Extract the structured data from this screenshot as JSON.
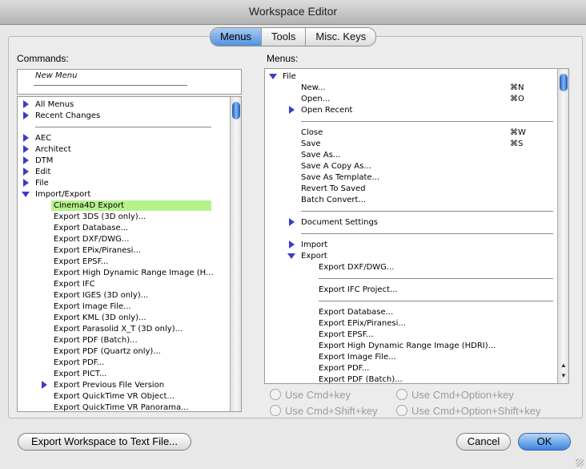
{
  "window": {
    "title": "Workspace Editor"
  },
  "tabs": [
    {
      "label": "Menus",
      "selected": true
    },
    {
      "label": "Tools",
      "selected": false
    },
    {
      "label": "Misc. Keys",
      "selected": false
    }
  ],
  "commands": {
    "label": "Commands:",
    "new_menu": "New Menu",
    "items": [
      {
        "label": "All Menus",
        "icon": "disclosure-right-icon"
      },
      {
        "label": "Recent Changes",
        "icon": "disclosure-right-icon"
      },
      {
        "separator": true
      },
      {
        "label": "AEC",
        "icon": "disclosure-right-icon"
      },
      {
        "label": "Architect",
        "icon": "disclosure-right-icon"
      },
      {
        "label": "DTM",
        "icon": "disclosure-right-icon"
      },
      {
        "label": "Edit",
        "icon": "disclosure-right-icon"
      },
      {
        "label": "File",
        "icon": "disclosure-right-icon"
      },
      {
        "label": "Import/Export",
        "icon": "disclosure-down-icon"
      },
      {
        "label": "Cinema4D Export",
        "indent": true,
        "highlight": true
      },
      {
        "label": "Export 3DS (3D only)...",
        "indent": true
      },
      {
        "label": "Export Database...",
        "indent": true
      },
      {
        "label": "Export DXF/DWG...",
        "indent": true
      },
      {
        "label": "Export EPix/Piranesi...",
        "indent": true
      },
      {
        "label": "Export EPSF...",
        "indent": true
      },
      {
        "label": "Export High Dynamic Range Image (H...",
        "indent": true
      },
      {
        "label": "Export IFC",
        "indent": true
      },
      {
        "label": "Export IGES (3D only)...",
        "indent": true
      },
      {
        "label": "Export Image File...",
        "indent": true
      },
      {
        "label": "Export KML (3D only)...",
        "indent": true
      },
      {
        "label": "Export Parasolid X_T (3D only)...",
        "indent": true
      },
      {
        "label": "Export PDF (Batch)...",
        "indent": true
      },
      {
        "label": "Export PDF (Quartz only)...",
        "indent": true
      },
      {
        "label": "Export PDF...",
        "indent": true
      },
      {
        "label": "Export PICT...",
        "indent": true
      },
      {
        "label": "Export Previous File Version",
        "indent": true,
        "icon": "disclosure-right-icon"
      },
      {
        "label": "Export QuickTime VR Object...",
        "indent": true
      },
      {
        "label": "Export QuickTime VR Panorama...",
        "indent": true
      }
    ]
  },
  "menus": {
    "label": "Menus:",
    "items": [
      {
        "label": "File",
        "level": 0,
        "icon": "disclosure-down-icon"
      },
      {
        "label": "New...",
        "level": 1,
        "shortcut": "⌘N"
      },
      {
        "label": "Open...",
        "level": 1,
        "shortcut": "⌘O"
      },
      {
        "label": "Open Recent",
        "level": 1,
        "icon": "disclosure-right-icon"
      },
      {
        "separator": true,
        "level": 1
      },
      {
        "label": "Close",
        "level": 1,
        "shortcut": "⌘W"
      },
      {
        "label": "Save",
        "level": 1,
        "shortcut": "⌘S"
      },
      {
        "label": "Save As...",
        "level": 1
      },
      {
        "label": "Save A Copy As...",
        "level": 1
      },
      {
        "label": "Save As Template...",
        "level": 1
      },
      {
        "label": "Revert To Saved",
        "level": 1
      },
      {
        "label": "Batch Convert...",
        "level": 1
      },
      {
        "separator": true,
        "level": 1
      },
      {
        "label": "Document Settings",
        "level": 1,
        "icon": "disclosure-right-icon"
      },
      {
        "separator": true,
        "level": 1
      },
      {
        "label": "Import",
        "level": 1,
        "icon": "disclosure-right-icon"
      },
      {
        "label": "Export",
        "level": 1,
        "icon": "disclosure-down-icon"
      },
      {
        "label": "Export DXF/DWG...",
        "level": 2
      },
      {
        "separator": true,
        "level": 2
      },
      {
        "label": "Export IFC Project...",
        "level": 2
      },
      {
        "separator": true,
        "level": 2
      },
      {
        "label": "Export Database...",
        "level": 2
      },
      {
        "label": "Export EPix/Piranesi...",
        "level": 2
      },
      {
        "label": "Export EPSF...",
        "level": 2
      },
      {
        "label": "Export High Dynamic Range Image (HDRI)...",
        "level": 2
      },
      {
        "label": "Export Image File...",
        "level": 2
      },
      {
        "label": "Export PDF...",
        "level": 2
      },
      {
        "label": "Export PDF (Batch)...",
        "level": 2
      }
    ]
  },
  "shortcut_options": [
    "Use Cmd+key",
    "Use Cmd+Option+key",
    "Use Cmd+Shift+key",
    "Use Cmd+Option+Shift+key"
  ],
  "buttons": {
    "export": "Export Workspace to Text File...",
    "cancel": "Cancel",
    "ok": "OK"
  },
  "colors": {
    "highlight": "#b6f28a",
    "accent": "#3a86de",
    "disclosure": "#3c3cc8"
  }
}
